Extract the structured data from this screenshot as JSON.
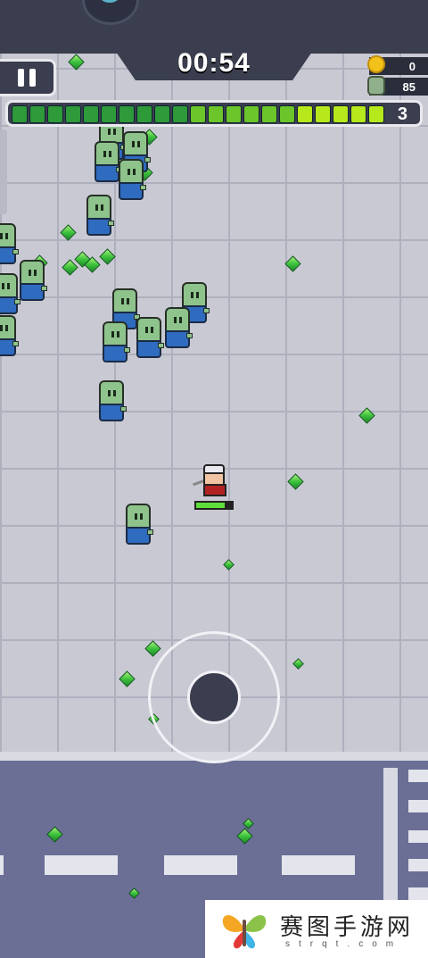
{
  "hud": {
    "timer": "00:54",
    "coins": "0",
    "kills": "85",
    "level": "3",
    "xp_progress": 0.87,
    "player_hp": 0.8
  },
  "watermark": {
    "title": "赛图手游网",
    "subtitle": "strqt.com"
  },
  "colors": {
    "xp_dark": "#2e9a3a",
    "xp_light": "#b7e81c",
    "hp": "#5ee03a",
    "gem": "#3cc23c",
    "zombie_skin": "#8ec38c",
    "zombie_shirt": "#2f6bbf"
  },
  "icons": [
    "pause-icon",
    "coin-icon",
    "zombie-skull-icon",
    "boss-icon",
    "gem-icon",
    "joystick-knob"
  ]
}
